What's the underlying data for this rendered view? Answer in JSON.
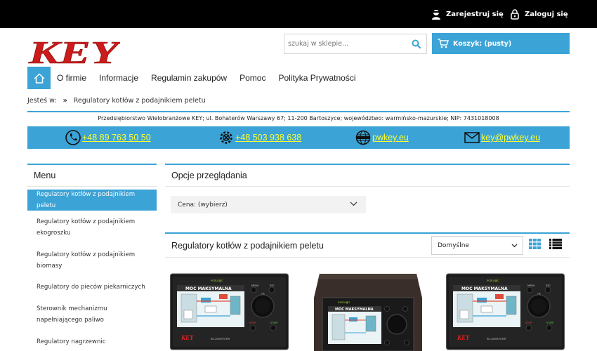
{
  "header": {
    "register_label": "Zarejestruj się",
    "login_label": "Zaloguj się",
    "logo_text": "KEY",
    "search_placeholder": "szukaj w sklepie...",
    "cart_label": "Koszyk: (pusty)"
  },
  "nav": {
    "items": [
      "O firmie",
      "Informacje",
      "Regulamin zakupów",
      "Pomoc",
      "Polityka Prywatności"
    ]
  },
  "breadcrumb": {
    "prefix": "Jesteś w:",
    "separator": "»",
    "current": "Regulatory kotłów z podajnikiem peletu"
  },
  "company_info": "Przedsiębiorstwo Wielobranżowe KEY; ul. Bohaterów Warszawy 67; 11-200 Bartoszyce; województwo: warmińsko-mazurskie; NIP: 7431018008",
  "contacts": {
    "phone1": "+48 89 763 50 50",
    "phone2": "+48 503 938 638",
    "website": "pwkey.eu",
    "email": "key@pwkey.eu"
  },
  "menu": {
    "title": "Menu",
    "items": [
      "Regulatory kotłów z podajnikiem peletu",
      "Regulatory kotłów z podajnikiem ekogroszku",
      "Regulatory kotłów z podajnikiem biomasy",
      "Regulatory do pieców piekarniczych",
      "Sterownik mechanizmu napełniającego paliwo",
      "Regulatory nagrzewnic"
    ],
    "active_index": 0
  },
  "browse": {
    "title": "Opcje przeglądania",
    "price_filter_label": "Cena: (wybierz)"
  },
  "listing": {
    "title": "Regulatory kotłów z podajnikiem peletu",
    "sort_selected": "Domyślne"
  },
  "product_screen": {
    "brand": "ecoLogic",
    "headline": "MOC MAKSYMALNA",
    "menu_label": "MENU",
    "esc_label": "ESC",
    "ok_label": "OK",
    "stop_label": "STOP",
    "start_label": "START",
    "model": "RK-2006SPOMR"
  },
  "colors": {
    "accent": "#3ba3d6",
    "logo_red": "#cc1b1b",
    "link_yellow": "#ffff33",
    "topbar": "#000000"
  }
}
